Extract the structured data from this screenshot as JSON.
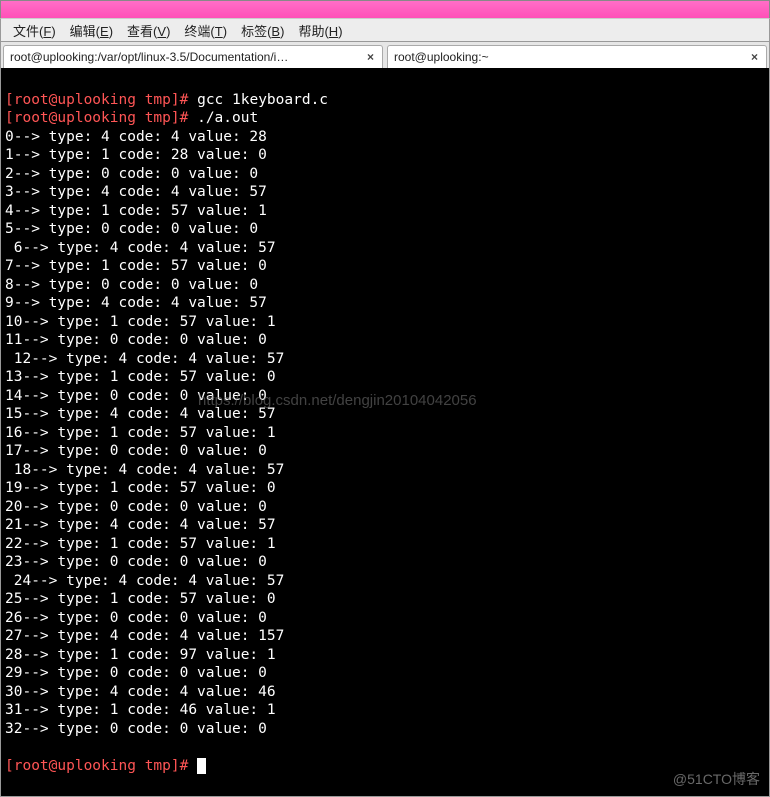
{
  "menubar": {
    "items": [
      {
        "label": "文件",
        "accel": "F"
      },
      {
        "label": "编辑",
        "accel": "E"
      },
      {
        "label": "查看",
        "accel": "V"
      },
      {
        "label": "终端",
        "accel": "T"
      },
      {
        "label": "标签",
        "accel": "B"
      },
      {
        "label": "帮助",
        "accel": "H"
      }
    ]
  },
  "tabs": [
    {
      "label": "root@uplooking:/var/opt/linux-3.5/Documentation/i…",
      "close": "×"
    },
    {
      "label": "root@uplooking:~",
      "close": "×"
    }
  ],
  "prompt": {
    "open": "[",
    "user_host": "root@uplooking",
    "sep": " ",
    "cwd": "tmp",
    "close": "]#"
  },
  "commands": [
    "gcc 1keyboard.c",
    "./a.out"
  ],
  "output": [
    "0--> type: 4 code: 4 value: 28",
    "1--> type: 1 code: 28 value: 0",
    "2--> type: 0 code: 0 value: 0",
    "3--> type: 4 code: 4 value: 57",
    "4--> type: 1 code: 57 value: 1",
    "5--> type: 0 code: 0 value: 0",
    " 6--> type: 4 code: 4 value: 57",
    "7--> type: 1 code: 57 value: 0",
    "8--> type: 0 code: 0 value: 0",
    "9--> type: 4 code: 4 value: 57",
    "10--> type: 1 code: 57 value: 1",
    "11--> type: 0 code: 0 value: 0",
    " 12--> type: 4 code: 4 value: 57",
    "13--> type: 1 code: 57 value: 0",
    "14--> type: 0 code: 0 value: 0",
    "15--> type: 4 code: 4 value: 57",
    "16--> type: 1 code: 57 value: 1",
    "17--> type: 0 code: 0 value: 0",
    " 18--> type: 4 code: 4 value: 57",
    "19--> type: 1 code: 57 value: 0",
    "20--> type: 0 code: 0 value: 0",
    "21--> type: 4 code: 4 value: 57",
    "22--> type: 1 code: 57 value: 1",
    "23--> type: 0 code: 0 value: 0",
    " 24--> type: 4 code: 4 value: 57",
    "25--> type: 1 code: 57 value: 0",
    "26--> type: 0 code: 0 value: 0",
    "27--> type: 4 code: 4 value: 157",
    "28--> type: 1 code: 97 value: 1",
    "29--> type: 0 code: 0 value: 0",
    "30--> type: 4 code: 4 value: 46",
    "31--> type: 1 code: 46 value: 1",
    "32--> type: 0 code: 0 value: 0"
  ],
  "watermarks": {
    "w1": "https://blog.csdn.net/dengjin20104042056",
    "w2": "@51CTO博客"
  }
}
